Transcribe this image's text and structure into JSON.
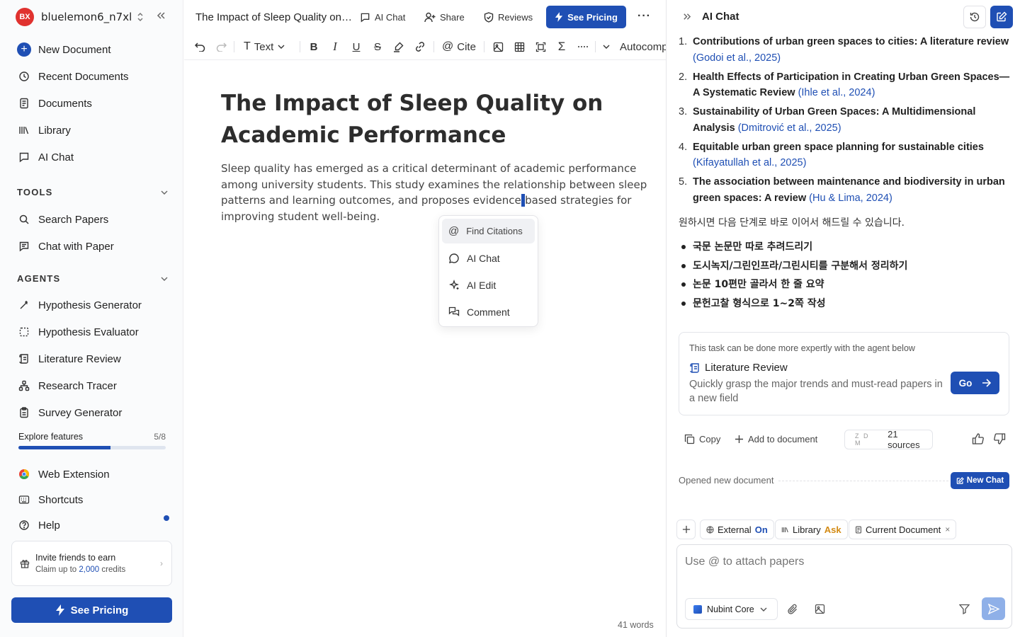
{
  "workspace": {
    "initials": "BX",
    "name": "bluelemon6_n7xl",
    "avatar_color": "#e0322f"
  },
  "sidebar": {
    "nav": [
      {
        "label": "New Document",
        "icon": "plus-circle-icon"
      },
      {
        "label": "Recent Documents",
        "icon": "clock-icon"
      },
      {
        "label": "Documents",
        "icon": "document-icon"
      },
      {
        "label": "Library",
        "icon": "library-icon"
      },
      {
        "label": "AI Chat",
        "icon": "chat-bubble-icon"
      }
    ],
    "tools_heading": "TOOLS",
    "tools": [
      {
        "label": "Search Papers",
        "icon": "search-icon"
      },
      {
        "label": "Chat with Paper",
        "icon": "chat-lines-icon"
      }
    ],
    "agents_heading": "AGENTS",
    "agents": [
      {
        "label": "Hypothesis Generator",
        "icon": "wand-icon"
      },
      {
        "label": "Hypothesis Evaluator",
        "icon": "dashed-square-icon"
      },
      {
        "label": "Literature Review",
        "icon": "scroll-icon"
      },
      {
        "label": "Research Tracer",
        "icon": "network-icon"
      },
      {
        "label": "Survey Generator",
        "icon": "clipboard-icon"
      }
    ],
    "explore": {
      "label": "Explore features",
      "count": "5/8",
      "progress": 0.625
    },
    "extras": [
      {
        "label": "Web Extension",
        "icon": "chrome-icon"
      },
      {
        "label": "Shortcuts",
        "icon": "keyboard-icon"
      },
      {
        "label": "Help",
        "icon": "help-icon"
      }
    ],
    "invite": {
      "title": "Invite friends to earn",
      "sub_prefix": "Claim up to",
      "amount": "2,000",
      "sub_suffix": "credits"
    },
    "see_pricing": "See Pricing"
  },
  "editor": {
    "doc_title": "The Impact of Sleep Quality on Academic Performance",
    "topbar": {
      "ai_chat": "AI Chat",
      "share": "Share",
      "reviews": "Reviews",
      "see_pricing": "See Pricing"
    },
    "toolbar": {
      "text_style": "Text",
      "cite": "Cite",
      "autocomplete": "Autocomp"
    },
    "heading": "The Impact of Sleep Quality on Academic Performance",
    "para_before": "Sleep quality has emerged as a critical determinant of academic performance among university students. This study examines the relationship between sleep patterns and learning outcomes, and proposes evidence",
    "para_caret": "-",
    "para_after": "based strategies for improving student well-being.",
    "popup": [
      "Find Citations",
      "AI Chat",
      "AI Edit",
      "Comment"
    ],
    "word_count": "41 words"
  },
  "chat": {
    "title": "AI Chat",
    "references": [
      {
        "n": "1.",
        "title": "Contributions of urban green spaces to cities: A literature review",
        "cite": "(Godoi et al., 2025)"
      },
      {
        "n": "2.",
        "title": "Health Effects of Participation in Creating Urban Green Spaces—A Systematic Review",
        "cite": "(Ihle et al., 2024)"
      },
      {
        "n": "3.",
        "title": "Sustainability of Urban Green Spaces: A Multidimensional Analysis",
        "cite": "(Dmitrović et al., 2025)"
      },
      {
        "n": "4.",
        "title": "Equitable urban green space planning for sustainable cities",
        "cite": "(Kifayatullah et al., 2025)"
      },
      {
        "n": "5.",
        "title": "The association between maintenance and biodiversity in urban green spaces: A review",
        "cite": "(Hu & Lima, 2024)"
      }
    ],
    "followup": "원하시면 다음 단계로 바로 이어서 해드릴 수 있습니다.",
    "bullets": [
      "국문 논문만 따로 추려드리기",
      "도시녹지/그린인프라/그린시티를 구분해서 정리하기",
      "논문 10편만 골라서 한 줄 요약",
      "문헌고찰 형식으로 1~2쪽 작성"
    ],
    "agent_card": {
      "hint": "This task can be done more expertly with the agent below",
      "name": "Literature Review",
      "desc": "Quickly grasp the major trends and must-read papers in a new field",
      "go": "Go"
    },
    "actions": {
      "copy": "Copy",
      "add": "Add to document",
      "sources": "21 sources",
      "source_logos": "Z D M"
    },
    "opened": "Opened new document",
    "new_chat": "New Chat",
    "chips": {
      "external": "External",
      "external_state": "On",
      "library": "Library",
      "library_state": "Ask",
      "current_doc": "Current Document"
    },
    "input_placeholder": "Use @ to attach papers",
    "model": "Nubint Core"
  },
  "colors": {
    "accent": "#1f4fb4",
    "ask": "#d38a13",
    "send_disabled": "#8fb0e8"
  }
}
